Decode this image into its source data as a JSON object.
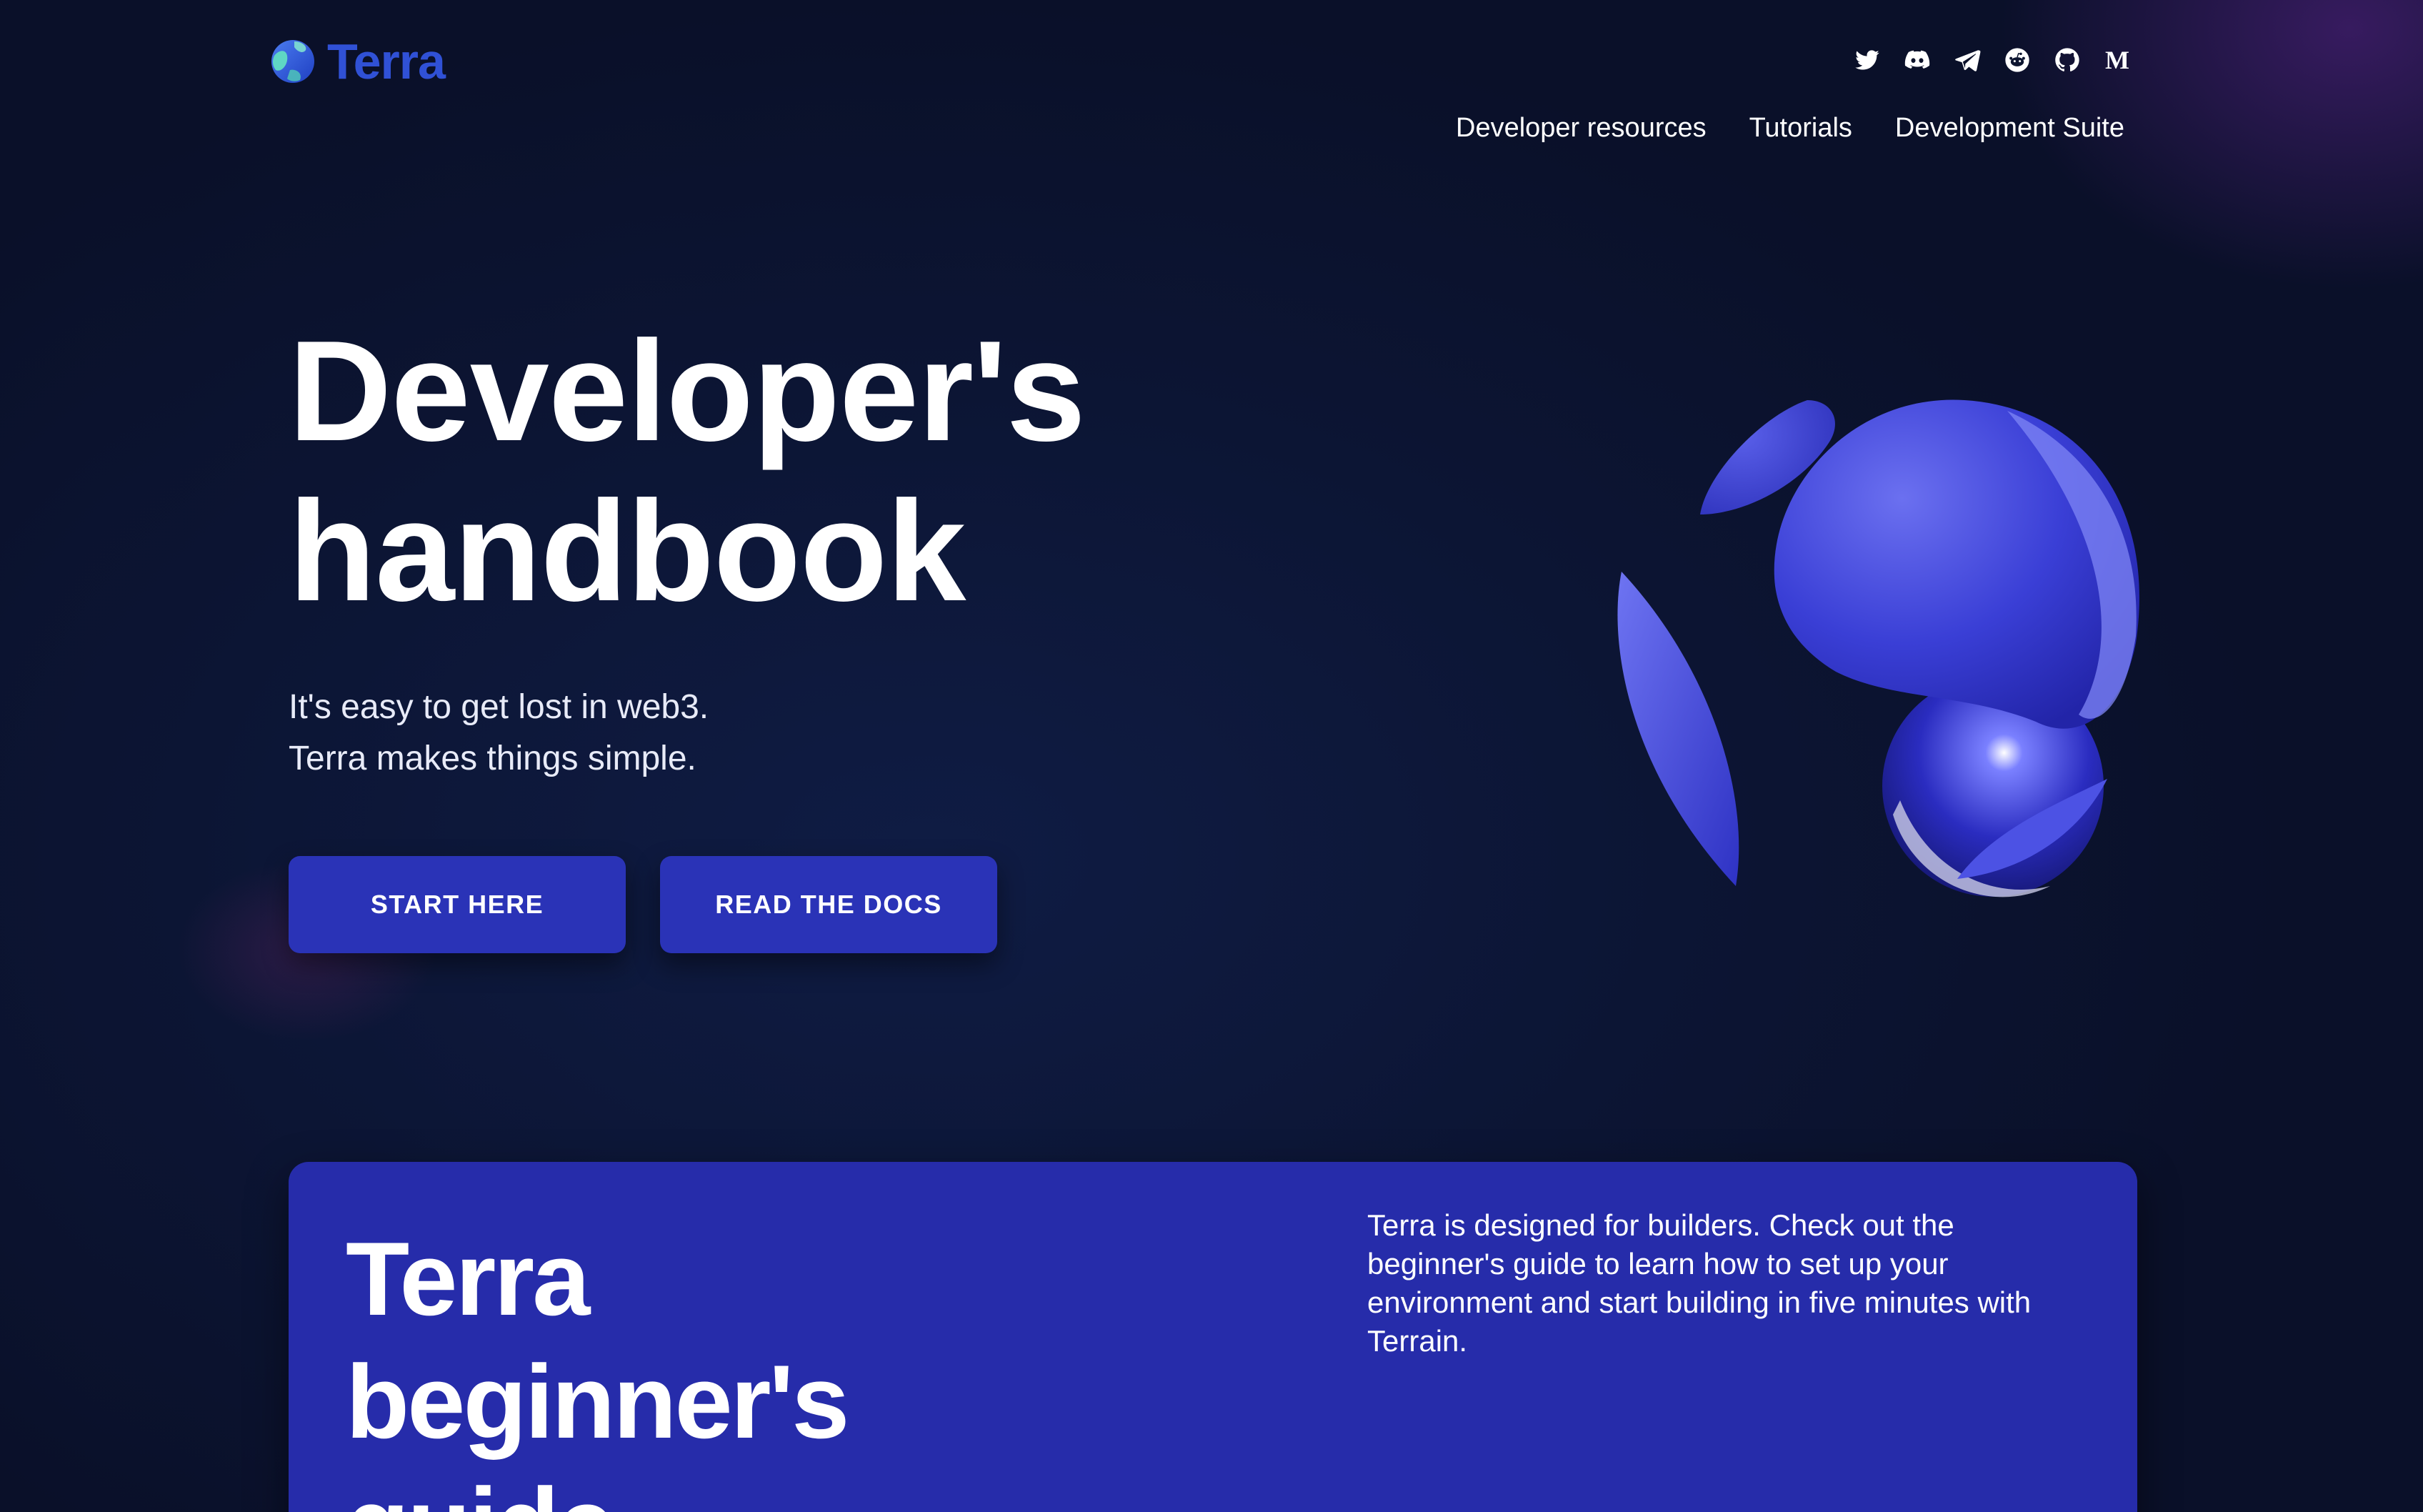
{
  "colors": {
    "background": "#0d1530",
    "primary_button": "#2a33b7",
    "card": "#262caa",
    "logo_text": "#3051d6",
    "globe_blue": "#3a3fd6"
  },
  "header": {
    "logo": {
      "text": "Terra",
      "icon": "terra-planet-icon"
    },
    "social": [
      {
        "name": "twitter",
        "icon": "twitter-icon"
      },
      {
        "name": "discord",
        "icon": "discord-icon"
      },
      {
        "name": "telegram",
        "icon": "telegram-icon"
      },
      {
        "name": "reddit",
        "icon": "reddit-icon"
      },
      {
        "name": "github",
        "icon": "github-icon"
      },
      {
        "name": "medium",
        "icon": "medium-icon",
        "glyph": "M"
      }
    ],
    "nav": [
      {
        "label": "Developer resources"
      },
      {
        "label": "Tutorials"
      },
      {
        "label": "Development Suite"
      }
    ]
  },
  "hero": {
    "title_line1": "Developer's",
    "title_line2": "handbook",
    "subtitle_line1": "It's easy to get lost in web3.",
    "subtitle_line2": "Terra makes things simple.",
    "primary_button": "START HERE",
    "secondary_button": "READ THE DOCS",
    "illustration": "terra-3d-globe-icon"
  },
  "card": {
    "title_line1": "Terra",
    "title_line2": "beginner's",
    "title_line3": "guide",
    "description": "Terra is designed for builders. Check out the beginner's guide to learn how to set up your environment and start building in five minutes with Terrain."
  }
}
